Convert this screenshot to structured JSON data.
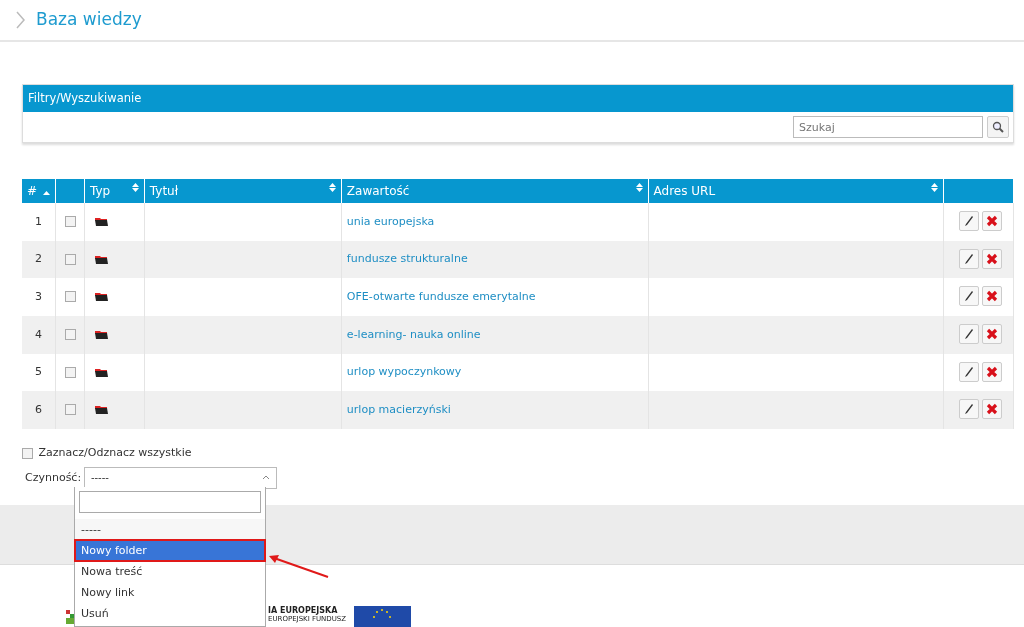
{
  "page_title": "Baza wiedzy",
  "filters": {
    "title": "Filtry/Wyszukiwanie",
    "search": {
      "placeholder": "Szukaj"
    }
  },
  "table": {
    "columns": [
      {
        "label": "#",
        "sortable": true,
        "sorted_ascending": true
      },
      {
        "sortable": false
      },
      {
        "label": "Typ",
        "sortable": true,
        "sorted_ascending": false
      },
      {
        "label": "Tytuł",
        "sortable": true,
        "sorted_ascending": false
      },
      {
        "label": "Zawartość",
        "sortable": true,
        "sorted_ascending": false
      },
      {
        "label": "Adres URL",
        "sortable": true,
        "sorted_ascending": false
      },
      {
        "sortable": false
      }
    ],
    "rows": [
      {
        "number": "1",
        "checked": false,
        "kind": "folder",
        "title": "",
        "content": "unia europejska",
        "url": ""
      },
      {
        "number": "2",
        "checked": false,
        "kind": "folder",
        "title": "",
        "content": "fundusze strukturalne",
        "url": ""
      },
      {
        "number": "3",
        "checked": false,
        "kind": "folder",
        "title": "",
        "content": "OFE-otwarte fundusze emerytalne",
        "url": ""
      },
      {
        "number": "4",
        "checked": false,
        "kind": "folder",
        "title": "",
        "content": "e-learning- nauka online",
        "url": ""
      },
      {
        "number": "5",
        "checked": false,
        "kind": "folder",
        "title": "",
        "content": "urlop wypoczynkowy",
        "url": ""
      },
      {
        "number": "6",
        "checked": false,
        "kind": "folder",
        "title": "",
        "content": "urlop macierzyński",
        "url": ""
      }
    ]
  },
  "select_all": {
    "label": "Zaznacz/Odznacz wszystkie",
    "checked": false
  },
  "action": {
    "label": "Czynność:",
    "value": "-----",
    "expanded": true,
    "options": [
      {
        "label": "-----",
        "selected": true,
        "highlighted": false
      },
      {
        "label": "Nowy folder",
        "selected": false,
        "highlighted": true
      },
      {
        "label": "Nowa treść",
        "selected": false,
        "highlighted": false
      },
      {
        "label": "Nowy link",
        "selected": false,
        "highlighted": false
      },
      {
        "label": "Usuń",
        "selected": false,
        "highlighted": false
      }
    ]
  },
  "footer": {
    "logo_text": [
      "IA EUROPEJSKA",
      "EUROPEJSKI FUNDUSZ"
    ]
  }
}
